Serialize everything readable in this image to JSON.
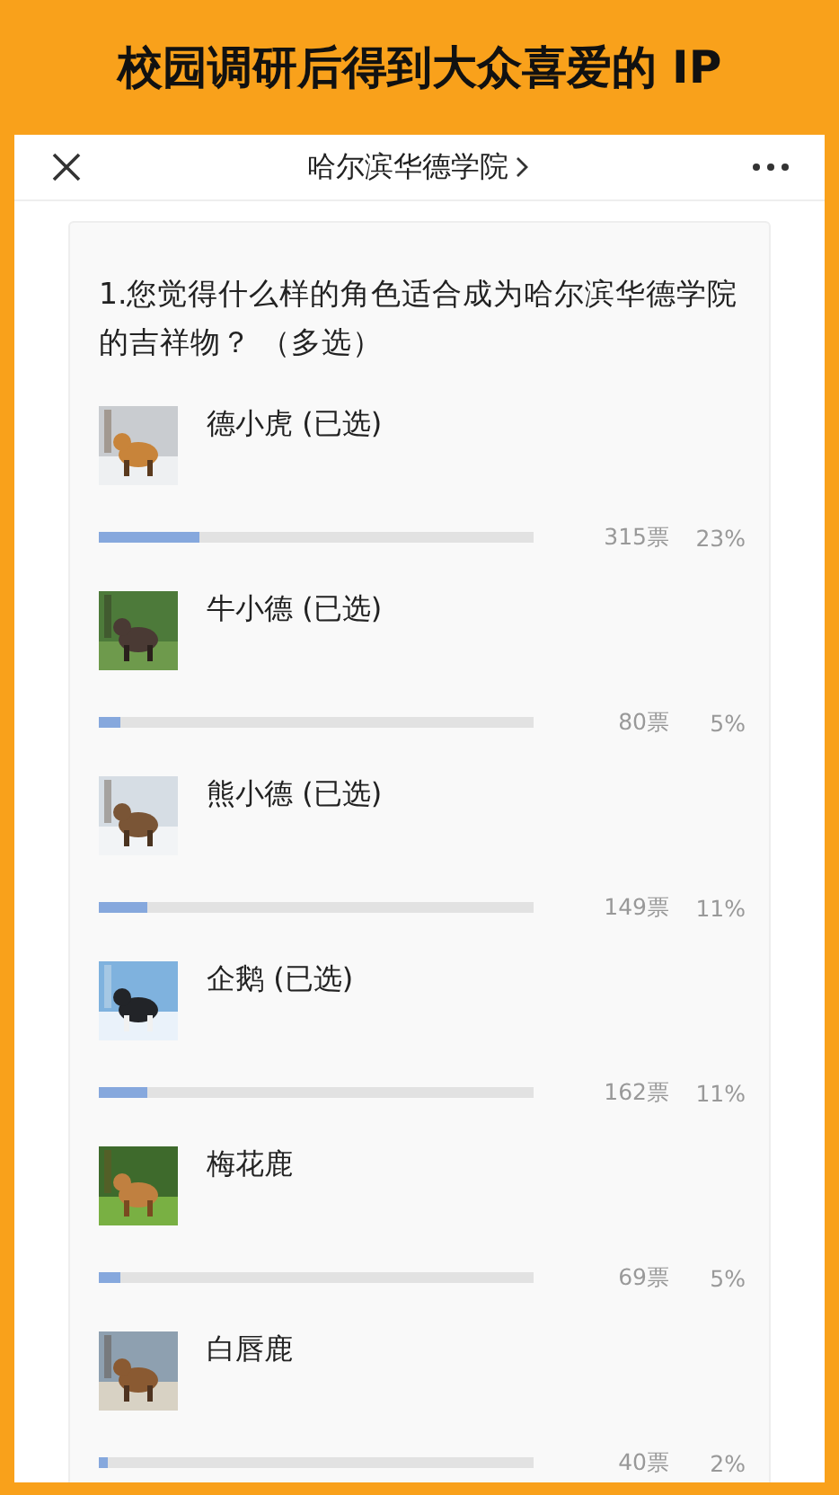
{
  "banner": {
    "title": "校园调研后得到大众喜爱的 IP"
  },
  "nav": {
    "title": "哈尔滨华德学院"
  },
  "poll": {
    "question": "1.您觉得什么样的角色适合成为哈尔滨华德学院的吉祥物？ （多选）",
    "options": [
      {
        "name": "德小虎 (已选)",
        "votes": "315票",
        "percent": "23%",
        "level": 0.23
      },
      {
        "name": "牛小德 (已选)",
        "votes": "80票",
        "percent": "5%",
        "level": 0.05
      },
      {
        "name": "熊小德 (已选)",
        "votes": "149票",
        "percent": "11%",
        "level": 0.11
      },
      {
        "name": "企鹅 (已选)",
        "votes": "162票",
        "percent": "11%",
        "level": 0.11
      },
      {
        "name": "梅花鹿",
        "votes": "69票",
        "percent": "5%",
        "level": 0.05
      },
      {
        "name": "白唇鹿",
        "votes": "40票",
        "percent": "2%",
        "level": 0.02
      }
    ]
  }
}
